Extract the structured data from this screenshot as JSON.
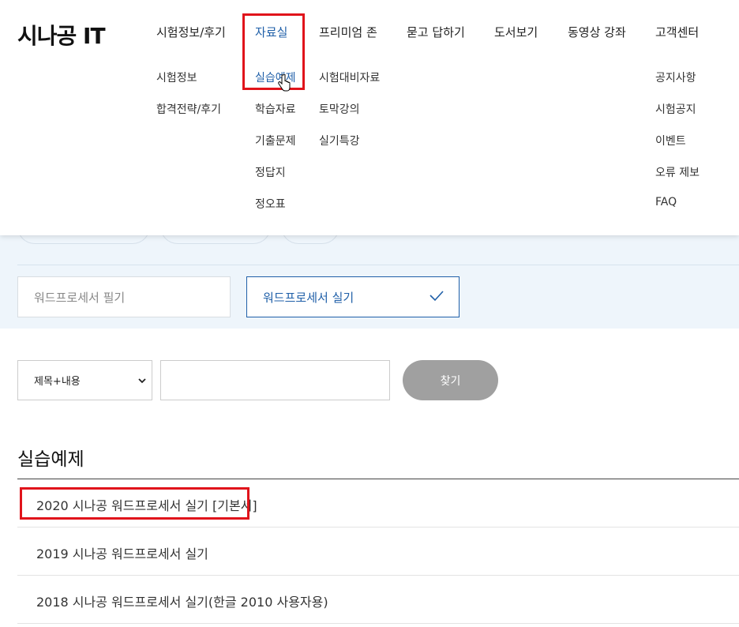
{
  "logo": "시나공 IT",
  "nav": {
    "columns": [
      {
        "label": "시험정보/후기",
        "items": [
          "시험정보",
          "합격전략/후기"
        ]
      },
      {
        "label": "자료실",
        "items": [
          "실습예제",
          "학습자료",
          "기출문제",
          "정답지",
          "정오표"
        ]
      },
      {
        "label": "프리미엄 존",
        "items": [
          "시험대비자료",
          "토막강의",
          "실기특강"
        ]
      },
      {
        "label": "묻고 답하기",
        "items": []
      },
      {
        "label": "도서보기",
        "items": []
      },
      {
        "label": "동영상 강좌",
        "items": []
      },
      {
        "label": "고객센터",
        "items": [
          "공지사항",
          "시험공지",
          "이벤트",
          "오류 제보",
          "FAQ"
        ]
      }
    ]
  },
  "category": {
    "options": [
      "워드프로세서 필기",
      "워드프로세서 실기"
    ],
    "selected": "워드프로세서 실기"
  },
  "search": {
    "type_selected": "제목+내용",
    "query": "",
    "button_label": "찾기"
  },
  "section": {
    "title": "실습예제",
    "items": [
      "2020 시나공 워드프로세서 실기 [기본서]",
      "2019 시나공 워드프로세서 실기",
      "2018 시나공 워드프로세서 실기(한글 2010 사용자용)"
    ]
  },
  "colors": {
    "accent": "#1f5fa8",
    "highlight": "#e0141b",
    "band": "#eef5fb",
    "button": "#a0a0a0"
  },
  "icons": {
    "check": "check-icon",
    "select_arrow": "chevron-down-icon",
    "pointer": "hand-cursor-icon"
  }
}
